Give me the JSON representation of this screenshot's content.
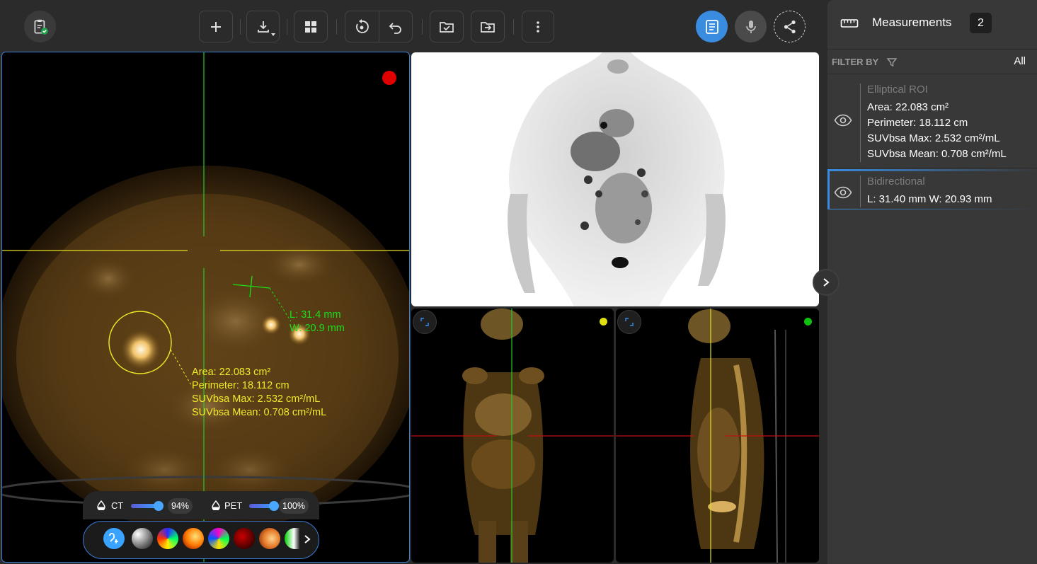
{
  "toolbar": {
    "left_icon": "clipboard-check-icon",
    "buttons": [
      "add-icon",
      "download-icon",
      "layout-grid-icon",
      "reset-icon",
      "undo-icon",
      "folder-check-icon",
      "folder-export-icon",
      "more-vert-icon"
    ],
    "right_icons": [
      "report-icon",
      "microphone-icon",
      "share-icon"
    ],
    "accent": "#3a8ce0"
  },
  "viewports": {
    "main": {
      "indicator_color": "#e00000",
      "ellipse_annotation": {
        "area": "Area: 22.083 cm²",
        "perimeter": "Perimeter: 18.112 cm",
        "suv_max": "SUVbsa Max: 2.532 cm²/mL",
        "suv_mean": "SUVbsa Mean: 0.708 cm²/mL"
      },
      "bidirectional_annotation": {
        "length": "L: 31.4 mm",
        "width": "W: 20.9 mm"
      }
    },
    "coronal": {
      "indicator_color": "#e0e010"
    },
    "sagittal": {
      "indicator_color": "#10c010"
    }
  },
  "fusion": {
    "ct_label": "CT",
    "ct_opacity": "94%",
    "ct_value": 0.94,
    "pet_label": "PET",
    "pet_opacity": "100%",
    "pet_value": 1.0,
    "colormaps": [
      "grayscale",
      "rainbow",
      "hot-iron",
      "spectral",
      "red-hot",
      "pet",
      "hot-green"
    ]
  },
  "panel": {
    "title": "Measurements",
    "count": "2",
    "filter_label": "FILTER BY",
    "filter_value": "All",
    "items": [
      {
        "name": "Elliptical ROI",
        "lines": [
          "Area: 22.083 cm²",
          "Perimeter: 18.112 cm",
          "SUVbsa Max: 2.532 cm²/mL",
          "SUVbsa Mean: 0.708 cm²/mL"
        ]
      },
      {
        "name": "Bidirectional",
        "lines": [
          "L: 31.40 mm W: 20.93 mm"
        ]
      }
    ]
  }
}
